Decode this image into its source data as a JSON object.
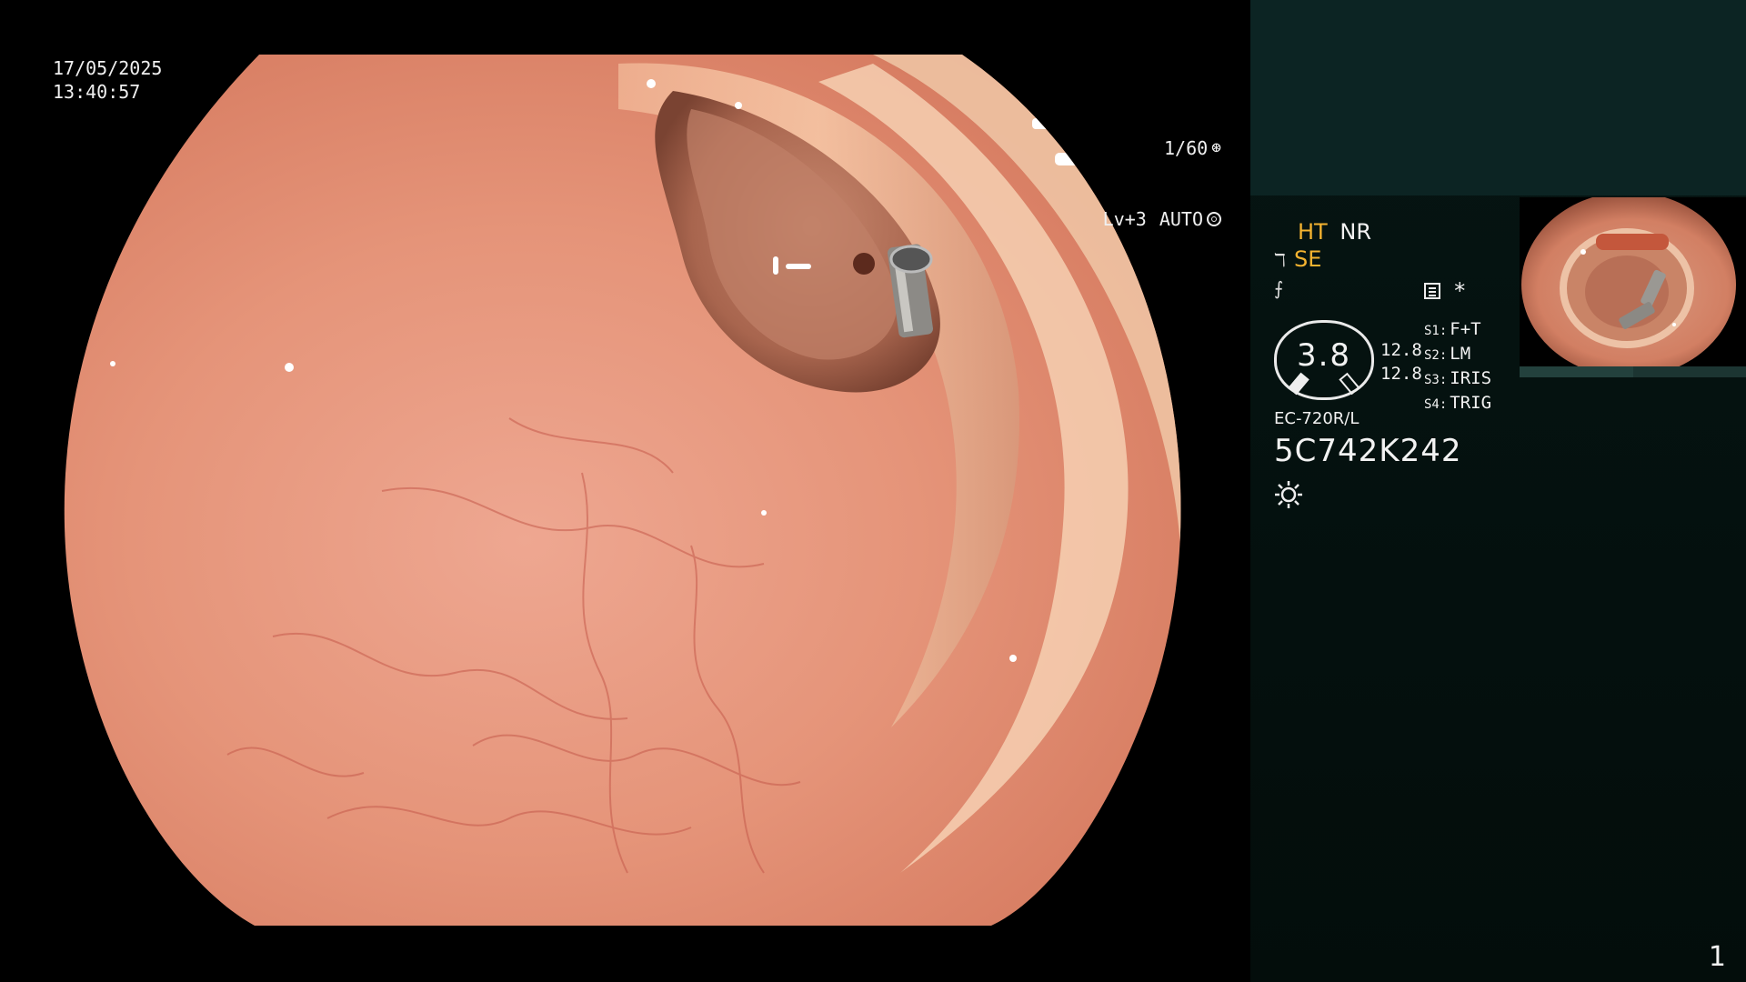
{
  "scope_view": {
    "date": "17/05/2025",
    "time": "13:40:57",
    "shutter": "1/60",
    "iris_level": "Lv+3",
    "iris_mode": "AUTO"
  },
  "side_panel": {
    "modes": {
      "ht": "HT",
      "nr": "NR",
      "se": "SE"
    },
    "gauge_value": "3.8",
    "readings": [
      "12.8",
      "12.8"
    ],
    "switches": [
      {
        "key": "S1:",
        "value": "F+T"
      },
      {
        "key": "S2:",
        "value": "LM"
      },
      {
        "key": "S3:",
        "value": "IRIS"
      },
      {
        "key": "S4:",
        "value": "TRIG"
      }
    ],
    "asterisk": "*",
    "scope_model": "EC-720R/L",
    "scope_serial": "5C742K242",
    "page_number": "1"
  },
  "icons": {
    "shutter_icon": "aperture-icon",
    "iris_icon": "iris-icon",
    "light_icon": "light-sun-icon",
    "list_icon": "settings-list-icon"
  },
  "colors": {
    "panel_background": "#0c2423",
    "highlight_text": "#f4b330",
    "mucosa": "#e08a6e"
  }
}
